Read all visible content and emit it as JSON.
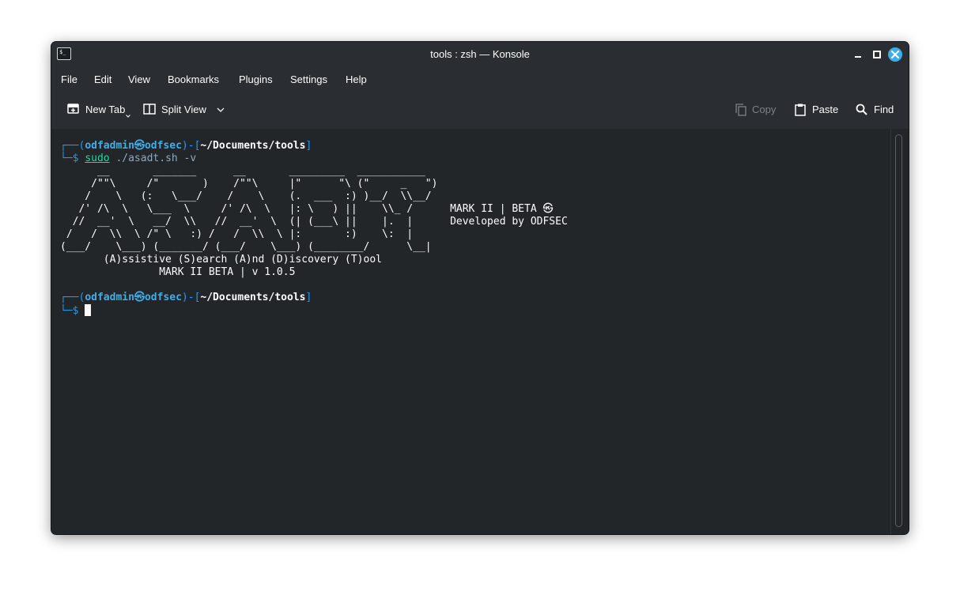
{
  "window": {
    "title": "tools : zsh — Konsole",
    "app_icon_glyph": "$_",
    "controls": [
      "minimize-icon",
      "maximize-icon",
      "close-icon"
    ],
    "accent_color": "#3daee9"
  },
  "menubar": {
    "items": [
      "File",
      "Edit",
      "View",
      "Bookmarks",
      "Plugins",
      "Settings",
      "Help"
    ]
  },
  "toolbar": {
    "new_tab": "New Tab",
    "split_view": "Split View",
    "copy": "Copy",
    "paste": "Paste",
    "find": "Find"
  },
  "terminal": {
    "prompt": {
      "box_top_open": "┌──(",
      "user": "odfadmin",
      "at_symbol": "㉿",
      "host": "odfsec",
      "mid": ")-[",
      "path": "~/Documents/tools",
      "close": "]",
      "box_bottom": "└─",
      "dollar": "$"
    },
    "command": "sudo",
    "command_args": " ./asadt.sh -v",
    "banner_lines": [
      "      __       _______      __       _________  ___________",
      "     /\"\"\\     /\"       )    /\"\"\\     |\"      \"\\ (\"     _   \")",
      "    /    \\   (:   \\___/    /    \\    (.  ___  :) )__/  \\\\__/",
      "   /' /\\  \\   \\___  \\     /' /\\  \\   |: \\   ) ||    \\\\_ /      MARK II | BETA ㉿",
      "  //  __'  \\   __/  \\\\   //  __'  \\  (| (___\\ ||    |.  |      Developed by ODFSEC",
      " /   /  \\\\  \\ /\" \\   :) /   /  \\\\  \\ |:       :)    \\:  |",
      "(___/    \\___) (_______/ (___/    \\___) (________/      \\__|",
      "       (A)ssistive (S)earch (A)nd (D)iscovery (T)ool",
      "                MARK II BETA | v 1.0.5"
    ]
  }
}
